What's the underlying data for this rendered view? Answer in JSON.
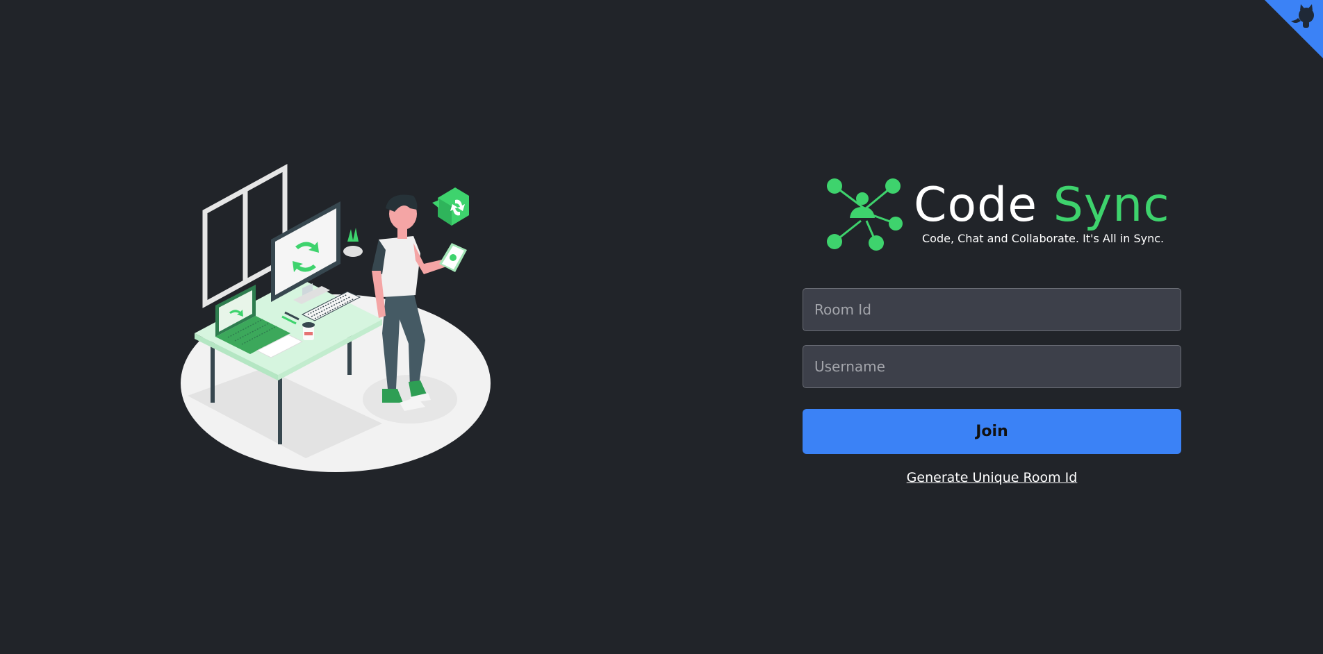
{
  "brand": {
    "title_part1": "Code",
    "title_part2": "Sync",
    "tagline": "Code, Chat and Collaborate. It's All in Sync.",
    "accent_color": "#3ed36d"
  },
  "form": {
    "room_id": {
      "value": "",
      "placeholder": "Room Id"
    },
    "username": {
      "value": "",
      "placeholder": "Username"
    },
    "join_label": "Join",
    "generate_label": "Generate Unique Room Id"
  },
  "corner": {
    "icon": "github-octocat-icon",
    "color": "#3b82f6"
  },
  "colors": {
    "background": "#212429",
    "input_bg": "#3d404a",
    "button_bg": "#3b82f6"
  }
}
